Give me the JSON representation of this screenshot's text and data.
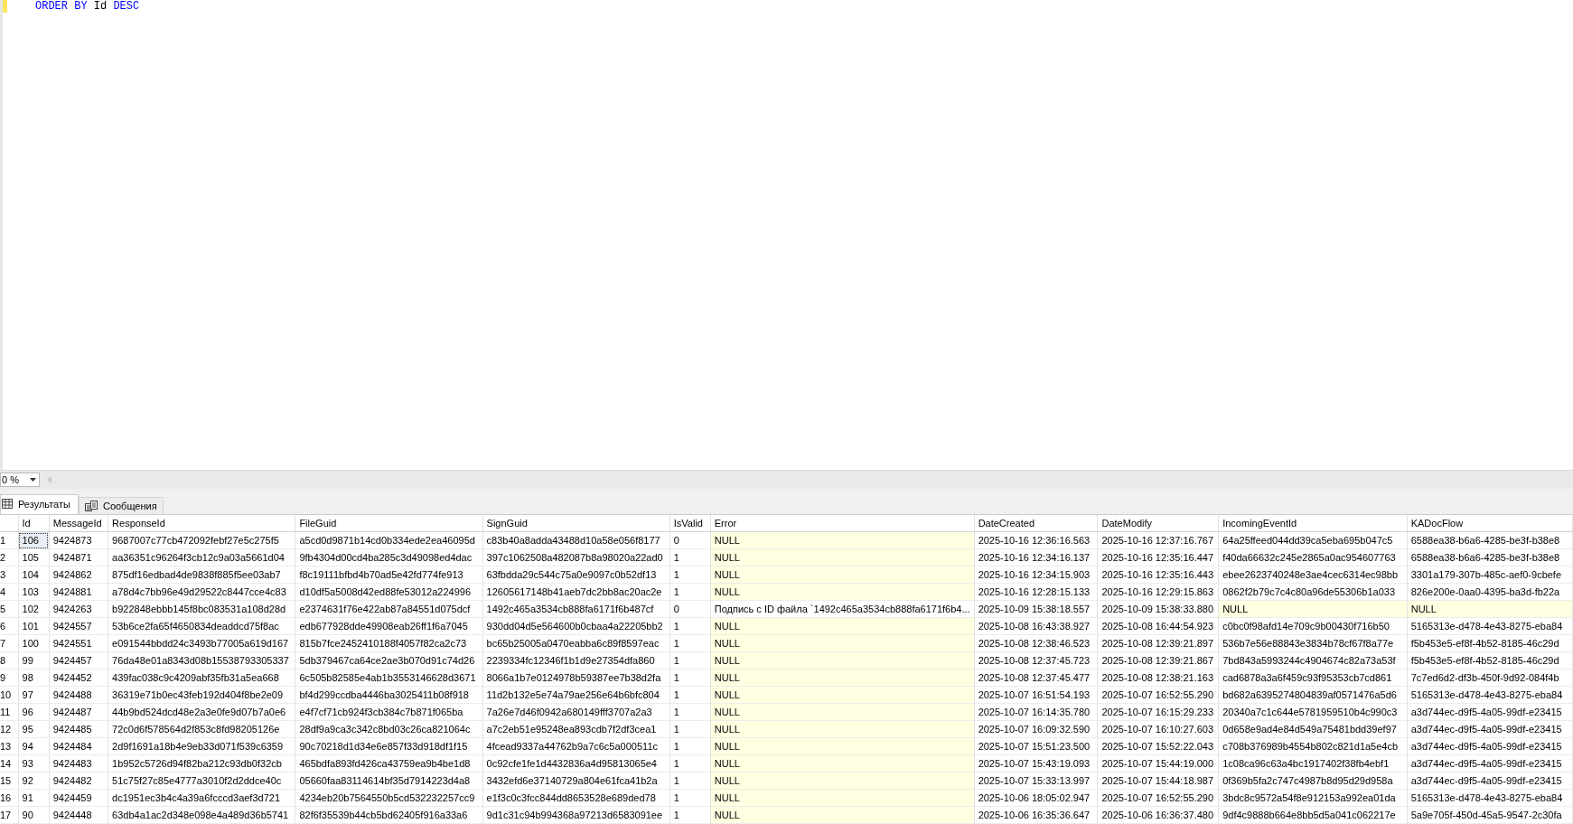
{
  "editor": {
    "code_line": [
      {
        "text": "ORDER BY",
        "kind": "keyword"
      },
      {
        "text": "Id",
        "kind": "identifier"
      },
      {
        "text": "DESC",
        "kind": "keyword"
      }
    ]
  },
  "zoom": {
    "value": "0 %"
  },
  "tabs": [
    {
      "label": "Результаты",
      "selected": true,
      "kind": "grid"
    },
    {
      "label": "Сообщения",
      "selected": false,
      "kind": "messages"
    }
  ],
  "table": {
    "columns": [
      "Id",
      "MessageId",
      "ResponseId",
      "FileGuid",
      "SignGuid",
      "IsValid",
      "Error",
      "DateCreated",
      "DateModify",
      "IncomingEventId",
      "KADocFlow"
    ],
    "rows": [
      {
        "num": "1",
        "focused": true,
        "cells": [
          "106",
          "9424873",
          "9687007c77cb472092febf27e5c275f5",
          "a5cd0d9871b14cd0b334ede2ea46095d",
          "c83b40a8adda43488d10a58e056f8177",
          "0",
          {
            "text": "NULL",
            "null": true
          },
          "2025-10-16 12:36:16.563",
          "2025-10-16 12:37:16.767",
          "64a25ffeed044dd39ca5eba695b047c5",
          "6588ea38-b6a6-4285-be3f-b38e8"
        ]
      },
      {
        "num": "2",
        "focused": false,
        "cells": [
          "105",
          "9424871",
          "aa36351c96264f3cb12c9a03a5661d04",
          "9fb4304d00cd4ba285c3d49098ed4dac",
          "397c1062508a482087b8a98020a22ad0",
          "1",
          {
            "text": "NULL",
            "null": true
          },
          "2025-10-16 12:34:16.137",
          "2025-10-16 12:35:16.447",
          "f40da66632c245e2865a0ac954607763",
          "6588ea38-b6a6-4285-be3f-b38e8"
        ]
      },
      {
        "num": "3",
        "focused": false,
        "cells": [
          "104",
          "9424862",
          "875df16edbad4de9838f885f5ee03ab7",
          "f8c19111bfbd4b70ad5e42fd774fe913",
          "63fbdda29c544c75a0e9097c0b52df13",
          "1",
          {
            "text": "NULL",
            "null": true
          },
          "2025-10-16 12:34:15.903",
          "2025-10-16 12:35:16.443",
          "ebee2623740248e3ae4cec6314ec98bb",
          "3301a179-307b-485c-aef0-9cbefe"
        ]
      },
      {
        "num": "4",
        "focused": false,
        "cells": [
          "103",
          "9424881",
          "a78d4c7bb96e49d29522c8447cce4c83",
          "d10df5a5008d42ed88fe53012a224996",
          "12605617148b41aeb7dc2bb8ac20ac2e",
          "1",
          {
            "text": "NULL",
            "null": true
          },
          "2025-10-16 12:28:15.133",
          "2025-10-16 12:29:15.863",
          "0862f2b79c7c4c80a96de55306b1a033",
          "826e200e-0aa0-4395-ba3d-fb22a"
        ]
      },
      {
        "num": "5",
        "focused": false,
        "cells": [
          "102",
          "9424263",
          "b922848ebbb145f8bc083531a108d28d",
          "e2374631f76e422ab87a84551d075dcf",
          "1492c465a3534cb888fa6171f6b487cf",
          "0",
          "Подпись с ID файла `1492c465a3534cb888fa6171f6b4...",
          "2025-10-09 15:38:18.557",
          "2025-10-09 15:38:33.880",
          {
            "text": "NULL",
            "null": true
          },
          {
            "text": "NULL",
            "null": true
          }
        ]
      },
      {
        "num": "6",
        "focused": false,
        "cells": [
          "101",
          "9424557",
          "53b6ce2fa65f4650834deaddcd75f8ac",
          "edb677928dde49908eab26ff1f6a7045",
          "930dd04d5e564600b0cbaa4a22205bb2",
          "1",
          {
            "text": "NULL",
            "null": true
          },
          "2025-10-08 16:43:38.927",
          "2025-10-08 16:44:54.923",
          "c0bc0f98afd14e709c9b00430f716b50",
          "5165313e-d478-4e43-8275-eba84"
        ]
      },
      {
        "num": "7",
        "focused": false,
        "cells": [
          "100",
          "9424551",
          "e091544bbdd24c3493b77005a619d167",
          "815b7fce2452410188f4057f82ca2c73",
          "bc65b25005a0470eabba6c89f8597eac",
          "1",
          {
            "text": "NULL",
            "null": true
          },
          "2025-10-08 12:38:46.523",
          "2025-10-08 12:39:21.897",
          "536b7e56e88843e3834b78cf67f8a77e",
          "f5b453e5-ef8f-4b52-8185-46c29d"
        ]
      },
      {
        "num": "8",
        "focused": false,
        "cells": [
          "99",
          "9424457",
          "76da48e01a8343d08b15538793305337",
          "5db379467ca64ce2ae3b070d91c74d26",
          "2239334fc12346f1b1d9e27354dfa860",
          "1",
          {
            "text": "NULL",
            "null": true
          },
          "2025-10-08 12:37:45.723",
          "2025-10-08 12:39:21.867",
          "7bd843a5993244c4904674c82a73a53f",
          "f5b453e5-ef8f-4b52-8185-46c29d"
        ]
      },
      {
        "num": "9",
        "focused": false,
        "cells": [
          "98",
          "9424452",
          "439fac038c9c4209abf35fb31a5ea668",
          "6c505b82585e4ab1b3553146628d3671",
          "8066a1b7e0124978b59387ee7b38d2fa",
          "1",
          {
            "text": "NULL",
            "null": true
          },
          "2025-10-08 12:37:45.477",
          "2025-10-08 12:38:21.163",
          "cad6878a3a6f459c93f95353cb7cd861",
          "7c7ed6d2-df3b-450f-9d92-084f4b"
        ]
      },
      {
        "num": "10",
        "focused": false,
        "cells": [
          "97",
          "9424488",
          "36319e71b0ec43feb192d404f8be2e09",
          "bf4d299ccdba4446ba3025411b08f918",
          "11d2b132e5e74a79ae256e64b6bfc804",
          "1",
          {
            "text": "NULL",
            "null": true
          },
          "2025-10-07 16:51:54.193",
          "2025-10-07 16:52:55.290",
          "bd682a6395274804839af0571476a5d6",
          "5165313e-d478-4e43-8275-eba84"
        ]
      },
      {
        "num": "11",
        "focused": false,
        "cells": [
          "96",
          "9424487",
          "44b9bd524dcd48e2a3e0fe9d07b7a0e6",
          "e4f7cf71cb924f3cb384c7b871f065ba",
          "7a26e7d46f0942a680149fff3707a2a3",
          "1",
          {
            "text": "NULL",
            "null": true
          },
          "2025-10-07 16:14:35.780",
          "2025-10-07 16:15:29.233",
          "20340a7c1c644e5781959510b4c990c3",
          "a3d744ec-d9f5-4a05-99df-e23415"
        ]
      },
      {
        "num": "12",
        "focused": false,
        "cells": [
          "95",
          "9424485",
          "72c0d6f578564d2f853c8fd98205126e",
          "28df9a9ca3c342c8bd03c26ca821064c",
          "a7c2eb51e95248ea893cdb7f2df3cea1",
          "1",
          {
            "text": "NULL",
            "null": true
          },
          "2025-10-07 16:09:32.590",
          "2025-10-07 16:10:27.603",
          "0d658e9ad4e84d549a75481bdd39ef97",
          "a3d744ec-d9f5-4a05-99df-e23415"
        ]
      },
      {
        "num": "13",
        "focused": false,
        "cells": [
          "94",
          "9424484",
          "2d9f1691a18b4e9eb33d071f539c6359",
          "90c70218d1d34e6e857f33d918df1f15",
          "4fcead9337a44762b9a7c6c5a000511c",
          "1",
          {
            "text": "NULL",
            "null": true
          },
          "2025-10-07 15:51:23.500",
          "2025-10-07 15:52:22.043",
          "c708b376989b4554b802c821d1a5e4cb",
          "a3d744ec-d9f5-4a05-99df-e23415"
        ]
      },
      {
        "num": "14",
        "focused": false,
        "cells": [
          "93",
          "9424483",
          "1b952c5726d94f82ba212c93db0f32cb",
          "465bdfa893fd426ca43759ea9b4be1d8",
          "0c92cfe1fe1d4432836a4d95813065e4",
          "1",
          {
            "text": "NULL",
            "null": true
          },
          "2025-10-07 15:43:19.093",
          "2025-10-07 15:44:19.000",
          "1c08ca96c63a4bc1917402f38fb4ebf1",
          "a3d744ec-d9f5-4a05-99df-e23415"
        ]
      },
      {
        "num": "15",
        "focused": false,
        "cells": [
          "92",
          "9424482",
          "51c75f27c85e4777a3010f2d2ddce40c",
          "05660faa83114614bf35d7914223d4a8",
          "3432efd6e37140729a804e61fca41b2a",
          "1",
          {
            "text": "NULL",
            "null": true
          },
          "2025-10-07 15:33:13.997",
          "2025-10-07 15:44:18.987",
          "0f369b5fa2c747c4987b8d95d29d958a",
          "a3d744ec-d9f5-4a05-99df-e23415"
        ]
      },
      {
        "num": "16",
        "focused": false,
        "cells": [
          "91",
          "9424459",
          "dc1951ec3b4c4a39a6fcccd3aef3d721",
          "4234eb20b7564550b5cd532232257cc9",
          "e1f3c0c3fcc844dd8653528e689ded78",
          "1",
          {
            "text": "NULL",
            "null": true
          },
          "2025-10-06 18:05:02.947",
          "2025-10-07 16:52:55.290",
          "3bdc8c9572a54f8e912153a992ea01da",
          "5165313e-d478-4e43-8275-eba84"
        ]
      },
      {
        "num": "17",
        "focused": false,
        "cells": [
          "90",
          "9424448",
          "63db4a1ac2d348e098e4a489d36b5741",
          "82f6f35539b44cb5bd62405f916a33a6",
          "9d1c31c94b994368a97213d6583091ee",
          "1",
          {
            "text": "NULL",
            "null": true
          },
          "2025-10-06 16:35:36.647",
          "2025-10-06 16:36:37.480",
          "9df4c9888b664e8bb5d5a041c062217e",
          "5a9e705f-450d-45a5-9547-2c30fa"
        ]
      }
    ]
  }
}
